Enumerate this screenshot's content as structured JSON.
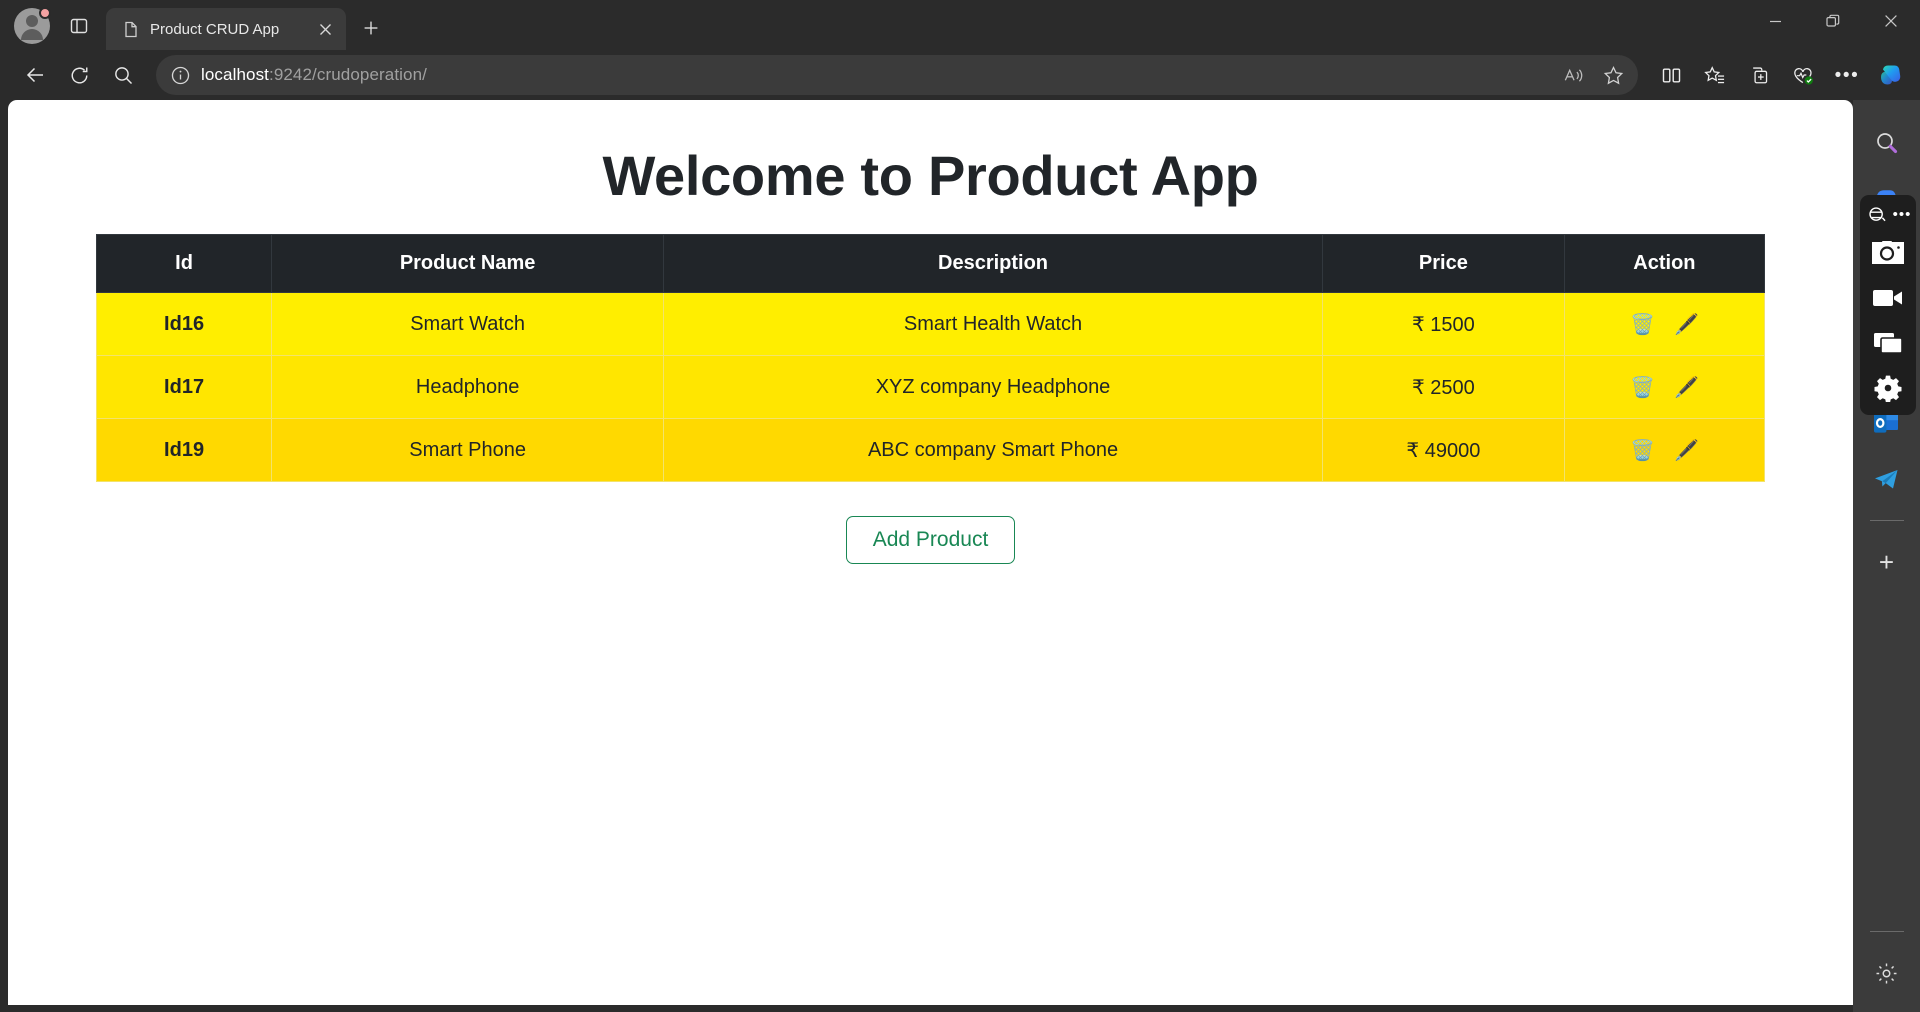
{
  "browser": {
    "profile": {
      "name": "profile-avatar",
      "badge": "notification-dot"
    },
    "tab": {
      "title": "Product CRUD App",
      "favicon": "page-icon",
      "close_label": "×"
    },
    "newtab_label": "+",
    "window_controls": {
      "minimize": "—",
      "restore": "restore",
      "close": "✕"
    },
    "toolbar": {
      "back": "back-arrow",
      "refresh": "refresh",
      "search": "search"
    },
    "address": {
      "security_icon": "info-icon",
      "host": "localhost",
      "path": ":9242/crudoperation/",
      "full_url": "localhost:9242/crudoperation/",
      "read_aloud": "read-aloud",
      "favorite": "star",
      "split_screen": "split-screen",
      "collections_star": "favorites-list",
      "add_collection": "add-to-collections",
      "browser_essentials": "browser-essentials",
      "settings_more": "•••",
      "copilot": "copilot"
    }
  },
  "page": {
    "title": "Welcome to Product App",
    "table": {
      "columns": [
        "Id",
        "Product Name",
        "Description",
        "Price",
        "Action"
      ],
      "rows": [
        {
          "id": "Id16",
          "name": "Smart Watch",
          "description": "Smart Health Watch",
          "price": "₹ 1500",
          "actions": {
            "delete": "🗑️",
            "edit": "🖋️"
          }
        },
        {
          "id": "Id17",
          "name": "Headphone",
          "description": "XYZ company Headphone",
          "price": "₹ 2500",
          "actions": {
            "delete": "🗑️",
            "edit": "🖋️"
          }
        },
        {
          "id": "Id19",
          "name": "Smart Phone",
          "description": "ABC company Smart Phone",
          "price": "₹ 49000",
          "actions": {
            "delete": "🗑️",
            "edit": "🖋️"
          }
        }
      ]
    },
    "add_product_label": "Add Product",
    "colors": {
      "header_bg": "#212529",
      "row_yellow": "#ffee00",
      "row_yellow_alt": "#ffd900",
      "add_button_accent": "#198754",
      "title_color": "#212529"
    }
  },
  "sidebar": {
    "items": [
      {
        "name": "search",
        "label": "search-magnifier"
      },
      {
        "name": "add",
        "label": "+"
      },
      {
        "name": "settings",
        "label": "settings-gear"
      }
    ],
    "apps": [
      {
        "name": "outlook",
        "label": "Outlook"
      },
      {
        "name": "telegram",
        "label": "Telegram"
      }
    ],
    "capture_panel": {
      "items": [
        {
          "name": "capture-mode",
          "label": "capture-mode"
        },
        {
          "name": "more",
          "label": "•••"
        },
        {
          "name": "screenshot",
          "label": "screenshot-camera"
        },
        {
          "name": "record-video",
          "label": "record-video"
        },
        {
          "name": "select-window",
          "label": "select-window"
        },
        {
          "name": "capture-settings",
          "label": "capture-settings"
        }
      ]
    }
  }
}
